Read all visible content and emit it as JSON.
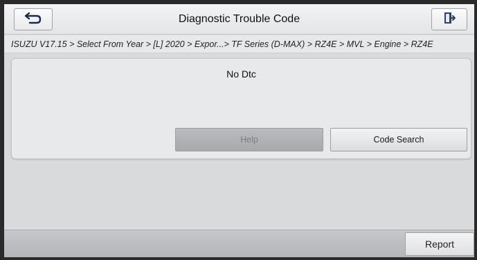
{
  "header": {
    "title": "Diagnostic Trouble Code",
    "back_icon": "back-arrow-icon",
    "exit_icon": "exit-door-icon"
  },
  "breadcrumb": {
    "path": "ISUZU V17.15 > Select From Year > [L] 2020 > Expor...> TF Series (D-MAX) > RZ4E > MVL > Engine > RZ4E"
  },
  "result": {
    "message": "No Dtc",
    "help_label": "Help",
    "code_search_label": "Code Search"
  },
  "footer": {
    "report_label": "Report"
  }
}
